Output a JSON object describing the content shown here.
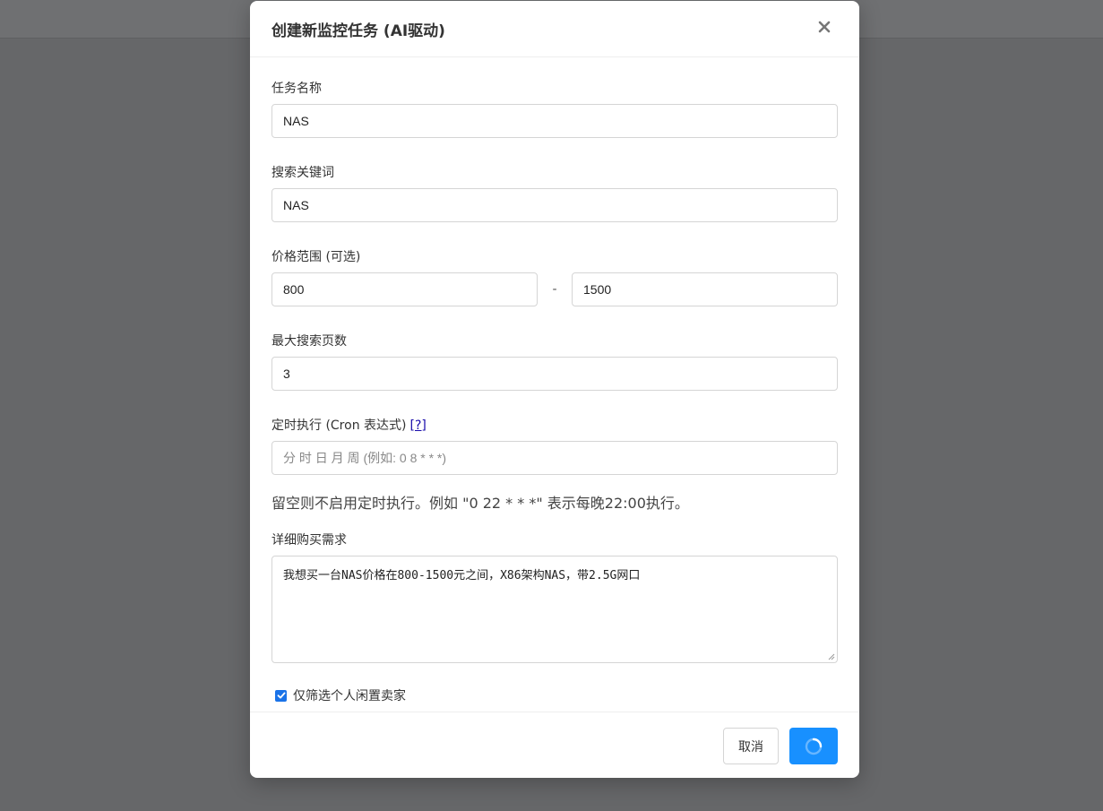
{
  "modal": {
    "title": "创建新监控任务 (AI驱动)",
    "close_icon": "close-icon"
  },
  "form": {
    "task_name": {
      "label": "任务名称",
      "value": "NAS"
    },
    "keyword": {
      "label": "搜索关键词",
      "value": "NAS"
    },
    "price_range": {
      "label": "价格范围 (可选)",
      "min": "800",
      "separator": "-",
      "max": "1500"
    },
    "max_pages": {
      "label": "最大搜索页数",
      "value": "3"
    },
    "cron": {
      "label": "定时执行 (Cron 表达式)",
      "help_link": "[?]",
      "placeholder": "分 时 日 月 周 (例如: 0 8 * * *)",
      "hint": "留空则不启用定时执行。例如 \"0 22 * * *\" 表示每晚22:00执行。"
    },
    "description": {
      "label": "详细购买需求",
      "value": "我想买一台NAS价格在800-1500元之间，X86架构NAS，带2.5G网口"
    },
    "personal_only": {
      "label": "仅筛选个人闲置卖家",
      "checked": true
    }
  },
  "footer": {
    "cancel_label": "取消",
    "submit_icon": "loading-spinner-icon"
  },
  "colors": {
    "primary": "#1890ff",
    "overlay": "#666769"
  }
}
